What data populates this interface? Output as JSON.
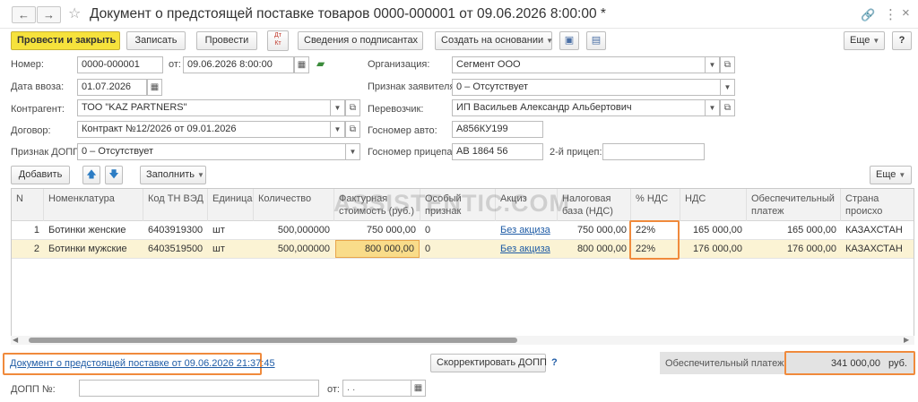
{
  "window": {
    "title": "Документ о предстоящей поставке товаров 0000-000001 от 09.06.2026 8:00:00 *",
    "back_icon": "arrow-left-icon",
    "forward_icon": "arrow-right-icon",
    "more_glyph": "⋮"
  },
  "toolbar": {
    "post_and_close": "Провести и закрыть",
    "save": "Записать",
    "post": "Провести",
    "signers": "Сведения о подписантах",
    "create_based_on": "Создать на основании",
    "more": "Еще"
  },
  "form": {
    "number_label": "Номер:",
    "number_value": "0000-000001",
    "from_label": "от:",
    "date_value": "09.06.2026  8:00:00",
    "org_label": "Организация:",
    "org_value": "Сегмент ООО",
    "import_date_label": "Дата ввоза:",
    "import_date_value": "01.07.2026",
    "applicant_label": "Признак заявителя:",
    "applicant_value": "0 – Отсутствует",
    "counterparty_label": "Контрагент:",
    "counterparty_value": "ТОО \"KAZ PARTNERS\"",
    "carrier_label": "Перевозчик:",
    "carrier_value": "ИП Васильев Александр Альбертович",
    "contract_label": "Договор:",
    "contract_value": "Контракт №12/2026 от 09.01.2026",
    "auto_plate_label": "Госномер авто:",
    "auto_plate_value": "А856КУ199",
    "dopp_sign_label": "Признак ДОПП:",
    "dopp_sign_value": "0 – Отсутствует",
    "trailer_label": "Госномер прицепа:",
    "trailer_value": "АВ 1864 56",
    "second_trailer_label": "2-й прицеп:",
    "second_trailer_value": ""
  },
  "table_toolbar": {
    "add": "Добавить",
    "fill": "Заполнить",
    "more": "Еще"
  },
  "table": {
    "headers": {
      "n": "N",
      "item": "Номенклатура",
      "code": "Код ТН ВЭД",
      "unit": "Единица",
      "qty": "Количество",
      "cost": "Фактурная стоимость (руб.)",
      "special": "Особый признак",
      "excise": "Акциз",
      "tax_base": "Налоговая база (НДС)",
      "vat_pct": "% НДС",
      "vat": "НДС",
      "guarantee": "Обеспечительный платеж",
      "country": "Страна происхо"
    },
    "rows": [
      {
        "n": "1",
        "item": "Ботинки женские",
        "code": "6403919300",
        "unit": "шт",
        "qty": "500,000000",
        "cost": "750 000,00",
        "special": "0",
        "excise": "Без акциза",
        "tax_base": "750 000,00",
        "vat_pct": "22%",
        "vat": "165 000,00",
        "guarantee": "165 000,00",
        "country": "КАЗАХСТАН"
      },
      {
        "n": "2",
        "item": "Ботинки мужские",
        "code": "6403519500",
        "unit": "шт",
        "qty": "500,000000",
        "cost": "800 000,00",
        "special": "0",
        "excise": "Без акциза",
        "tax_base": "800 000,00",
        "vat_pct": "22%",
        "vat": "176 000,00",
        "guarantee": "176 000,00",
        "country": "КАЗАХСТАН"
      }
    ]
  },
  "watermark": "ASSISTENTIC.COM",
  "footer": {
    "doc_link": "Документ о предстоящей поставке от 09.06.2026 21:37:45",
    "correct_dopp": "Скорректировать ДОПП",
    "help": "?",
    "guarantee_label": "Обеспечительный платеж:",
    "guarantee_value": "341 000,00",
    "currency": "руб.",
    "dopp_no_label": "ДОПП №:",
    "dopp_no_value": "",
    "from_label": "от:",
    "dopp_date_placeholder": " .  .    "
  },
  "colors": {
    "primary_button": "#f6e23c",
    "highlight_row": "#fbf3d4",
    "link": "#1f5ca6",
    "annotation_orange": "#f08a3c"
  }
}
